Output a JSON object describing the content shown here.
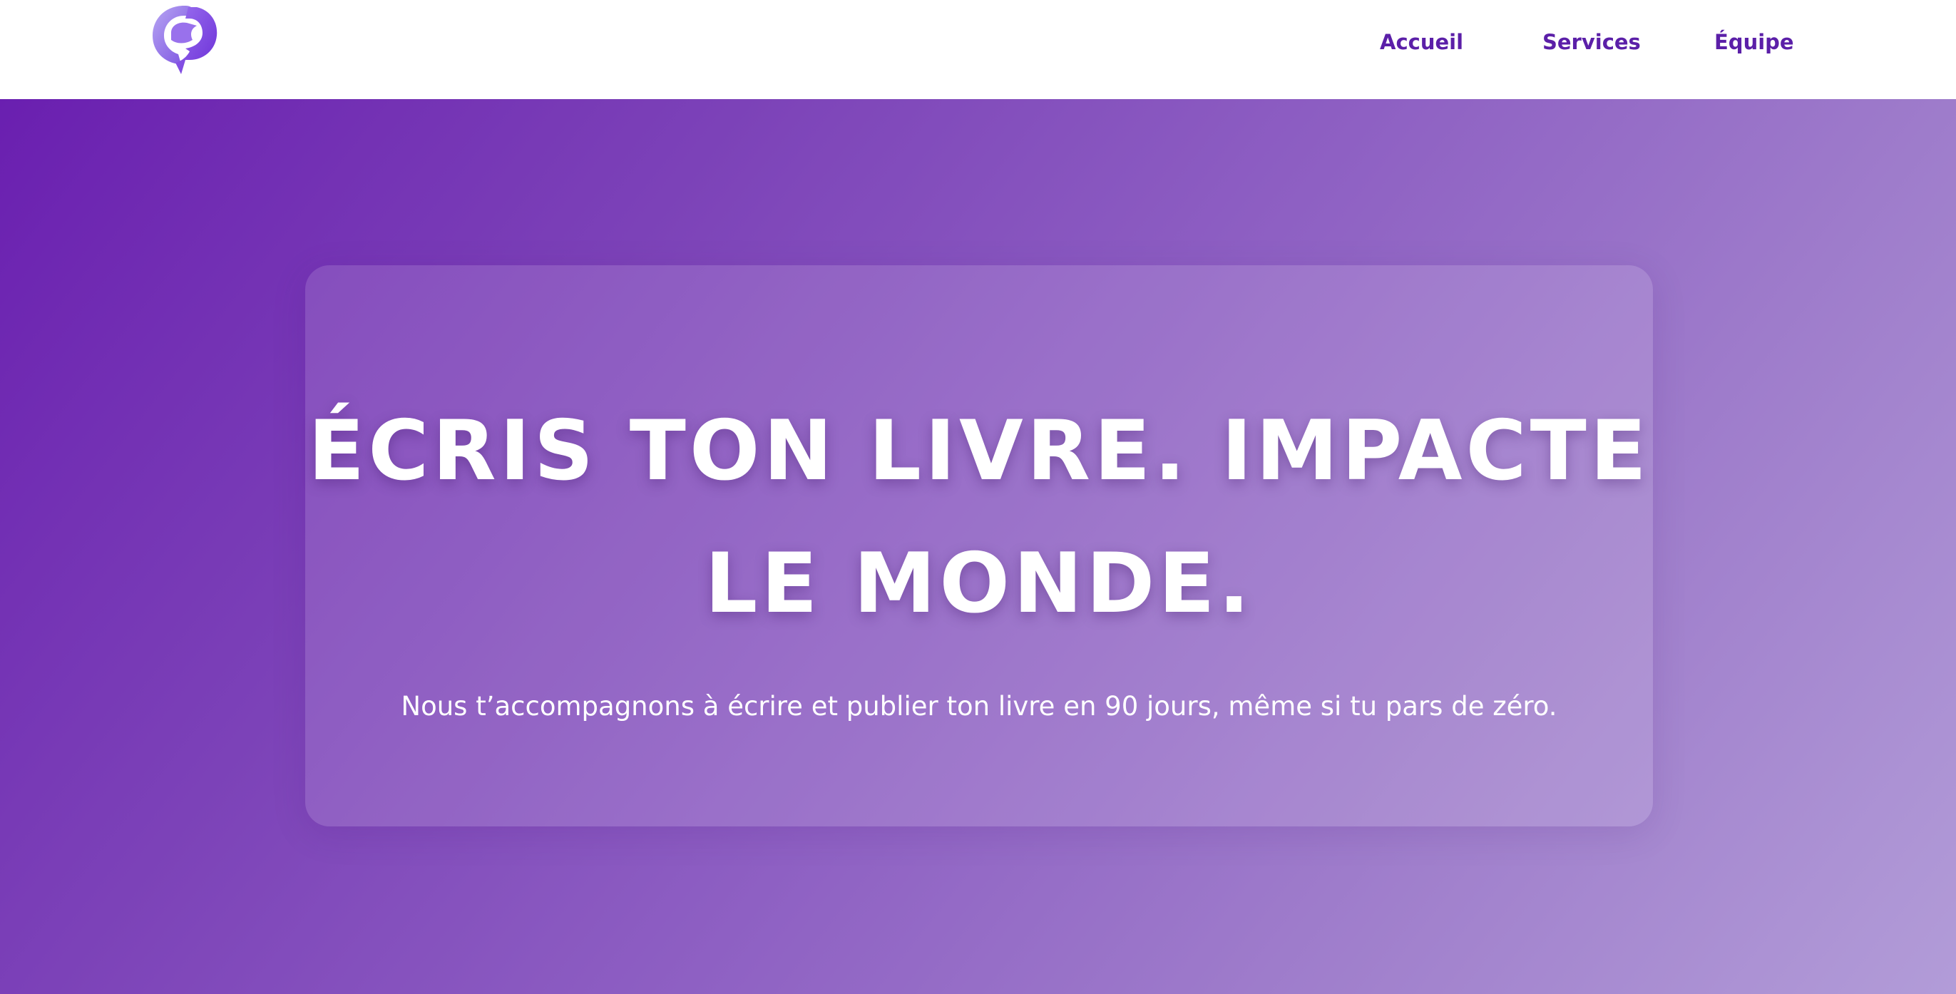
{
  "nav": {
    "logo_icon": "speech-bubble-logo-icon",
    "items": [
      {
        "label": "Accueil"
      },
      {
        "label": "Services"
      },
      {
        "label": "Équipe"
      }
    ]
  },
  "hero": {
    "headline_line1": "ÉCRIS TON LIVRE. IMPACTE",
    "headline_line2": "LE MONDE.",
    "subtitle": "Nous t’accompagnons à écrire et publier ton livre en 90 jours, même si tu pars de zéro."
  },
  "colors": {
    "accent": "#5b1fa8",
    "gradient_start": "#6a1fb0",
    "gradient_end": "#b29cd8",
    "text_on_hero": "#ffffff"
  }
}
